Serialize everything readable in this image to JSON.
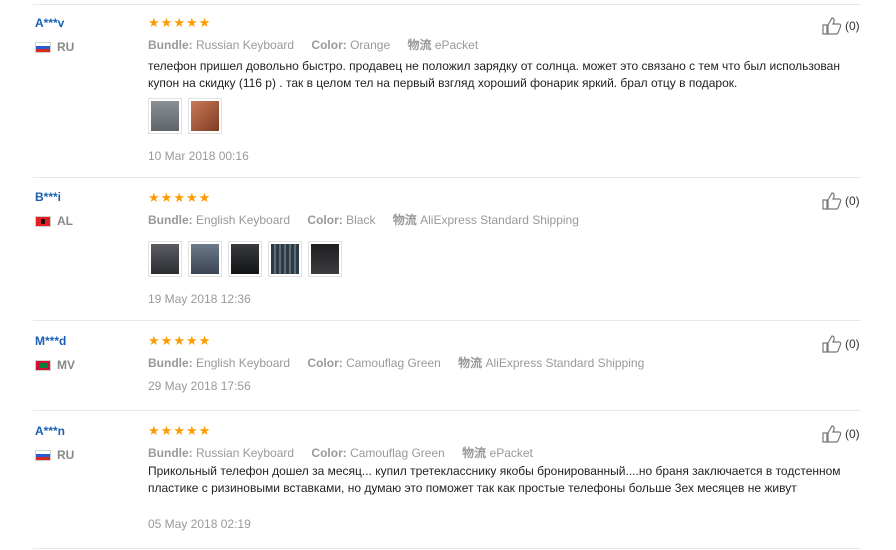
{
  "reviews": [
    {
      "user": "A***v",
      "country": "RU",
      "flag": "ru",
      "bundle_label": "Bundle:",
      "bundle": "Russian Keyboard",
      "color_label": "Color:",
      "color": "Orange",
      "shipping_label": "物流",
      "shipping": "ePacket",
      "text": "телефон пришел довольно быстро. продавец не положил зарядку от солнца. может это связано с тем что был использован купон на скидку (116 р) . так в целом тел на первый взгляд хороший фонарик яркий. брал отцу в подарок.",
      "photos": [
        "#6a6f76",
        "#a8553c"
      ],
      "date": "10 Mar 2018 00:16",
      "likes": "(0)",
      "rating": 5
    },
    {
      "user": "B***i",
      "country": "AL",
      "flag": "al",
      "bundle_label": "Bundle:",
      "bundle": "English Keyboard",
      "color_label": "Color:",
      "color": "Black",
      "shipping_label": "物流",
      "shipping": "AliExpress Standard Shipping",
      "text": "",
      "photos": [
        "#3a3d42",
        "#4d5867",
        "#202226",
        "#34404a",
        "#2a2a2a"
      ],
      "date": "19 May 2018 12:36",
      "likes": "(0)",
      "rating": 5
    },
    {
      "user": "M***d",
      "country": "MV",
      "flag": "mv",
      "bundle_label": "Bundle:",
      "bundle": "English Keyboard",
      "color_label": "Color:",
      "color": "Camouflag Green",
      "shipping_label": "物流",
      "shipping": "AliExpress Standard Shipping",
      "text": "",
      "photos": [],
      "date": "29 May 2018 17:56",
      "likes": "(0)",
      "rating": 5
    },
    {
      "user": "A***n",
      "country": "RU",
      "flag": "ru",
      "bundle_label": "Bundle:",
      "bundle": "Russian Keyboard",
      "color_label": "Color:",
      "color": "Camouflag Green",
      "shipping_label": "物流",
      "shipping": "ePacket",
      "text": "Прикольный телефон дошел за месяц... купил третеклас­снику якобы бронированный....но браня заключается в тодстенном пластике с ризиновыми вставками, но думаю это поможет так как простые телефоны больше 3ех месяцев не живут",
      "photos": [],
      "date": "05 May 2018 02:19",
      "likes": "(0)",
      "rating": 5
    }
  ]
}
